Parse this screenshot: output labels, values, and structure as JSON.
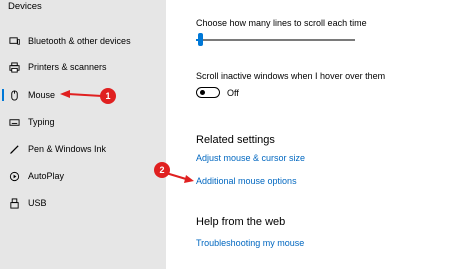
{
  "sidebar": {
    "header": "Devices",
    "items": [
      {
        "label": "Bluetooth & other devices",
        "icon": "bluetooth-devices-icon"
      },
      {
        "label": "Printers & scanners",
        "icon": "printer-icon"
      },
      {
        "label": "Mouse",
        "icon": "mouse-icon",
        "selected": true
      },
      {
        "label": "Typing",
        "icon": "keyboard-icon"
      },
      {
        "label": "Pen & Windows Ink",
        "icon": "pen-icon"
      },
      {
        "label": "AutoPlay",
        "icon": "autoplay-icon"
      },
      {
        "label": "USB",
        "icon": "usb-icon"
      }
    ]
  },
  "main": {
    "scroll_lines_label": "Choose how many lines to scroll each time",
    "scroll_lines_value": 3,
    "scroll_lines_fraction": 0.03,
    "inactive_scroll_label": "Scroll inactive windows when I hover over them",
    "inactive_scroll_state": "Off",
    "related_settings": {
      "title": "Related settings",
      "links": [
        "Adjust mouse & cursor size",
        "Additional mouse options"
      ]
    },
    "help": {
      "title": "Help from the web",
      "links": [
        "Troubleshooting my mouse"
      ]
    }
  },
  "annotations": {
    "badges": [
      "1",
      "2"
    ],
    "color": "#e02020"
  },
  "colors": {
    "accent": "#0078d7",
    "link": "#0067c0",
    "sidebar_bg": "#e6e6e6"
  }
}
